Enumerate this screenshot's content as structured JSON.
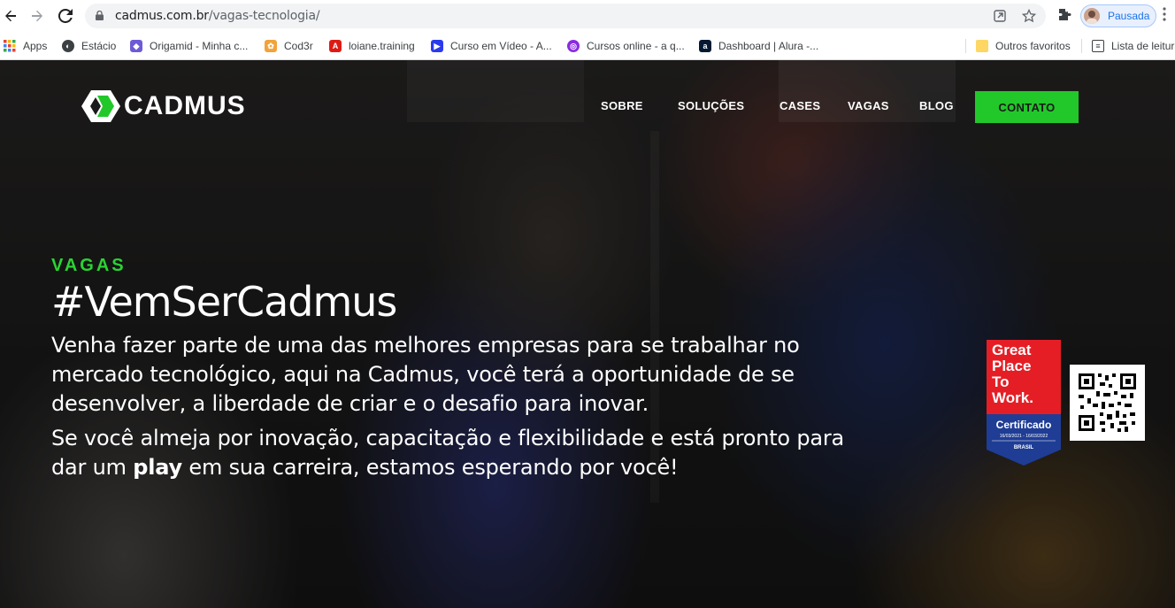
{
  "browser": {
    "url_host": "cadmus.com.br",
    "url_path": "/vagas-tecnologia/",
    "profile_label": "Pausada",
    "bookmarks": [
      {
        "label": "Apps",
        "icon": "apps-grid-icon"
      },
      {
        "label": "Estácio",
        "icon": "globe-icon"
      },
      {
        "label": "Origamid - Minha c...",
        "icon": "origamid-icon"
      },
      {
        "label": "Cod3r",
        "icon": "cod3r-icon"
      },
      {
        "label": "loiane.training",
        "icon": "angular-icon"
      },
      {
        "label": "Curso em Vídeo - A...",
        "icon": "curso-em-video-icon"
      },
      {
        "label": "Cursos online - a q...",
        "icon": "cursos-online-icon"
      },
      {
        "label": "Dashboard | Alura -...",
        "icon": "alura-icon"
      },
      {
        "label": "Outros favoritos",
        "icon": "folder-icon"
      },
      {
        "label": "Lista de leitura",
        "icon": "reading-list-icon"
      }
    ]
  },
  "site": {
    "logo_text": "CADMUS",
    "nav": [
      "SOBRE",
      "SOLUÇÕES",
      "CASES",
      "VAGAS",
      "BLOG"
    ],
    "contact_label": "CONTATO",
    "colors": {
      "accent": "#22c82a",
      "kicker": "#2bd333"
    }
  },
  "hero": {
    "kicker": "VAGAS",
    "headline": "#VemSerCadmus",
    "paragraph1": "Venha fazer parte de uma das melhores empresas para se trabalhar no mercado tecnológico, aqui na Cadmus, você terá a oportunidade de se desenvolver, a liberdade de criar e o desafio para inovar.",
    "paragraph2_before": "Se você almeja por inovação, capacitação e flexibilidade e está pronto para dar um ",
    "paragraph2_bold": "play",
    "paragraph2_after": " em sua carreira, estamos esperando por você!"
  },
  "badge": {
    "line1": "Great",
    "line2": "Place",
    "line3": "To",
    "line4": "Work.",
    "certified": "Certificado",
    "dates": "16/03/2021 - 16/03/2022",
    "country": "BRASIL"
  }
}
